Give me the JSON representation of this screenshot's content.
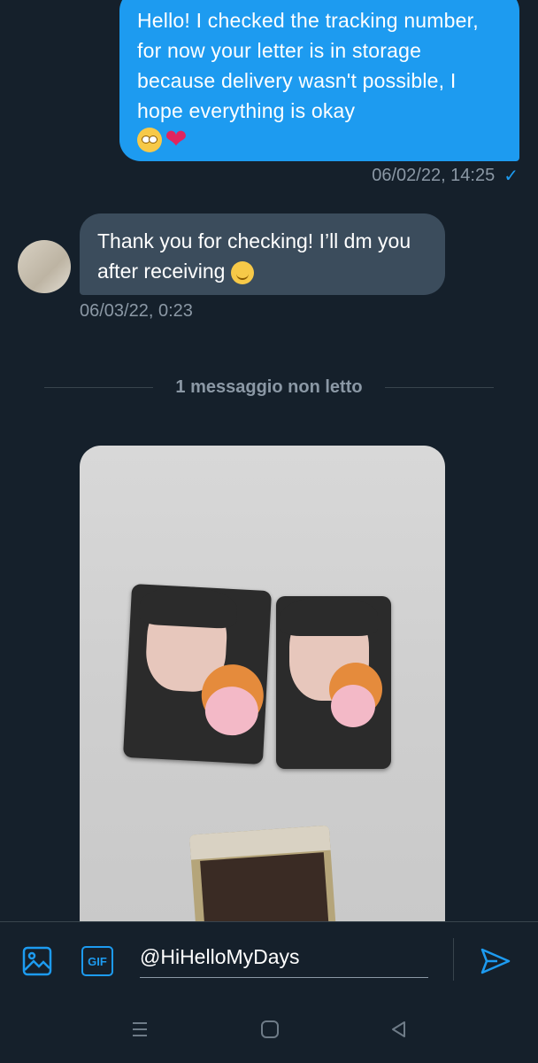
{
  "messages": {
    "outgoing": {
      "text": "Hello! I checked the tracking number, for now your letter is in storage because delivery wasn't possible, I hope everything is okay",
      "emojis": [
        "face-with-rolling-eyes",
        "red-heart"
      ],
      "timestamp": "06/02/22, 14:25",
      "status_icon": "sent-check-icon"
    },
    "incoming": {
      "text": "Thank you for checking! I’ll dm you after receiving",
      "emoji": "smiling-face",
      "timestamp": "06/03/22, 0:23"
    },
    "unread_label": "1 messaggio non letto"
  },
  "compose": {
    "input_value": "@HiHelloMyDays",
    "media_icon": "image-icon",
    "gif_label": "GIF",
    "send_icon": "send-icon"
  },
  "colors": {
    "background": "#15202b",
    "outgoing_bubble": "#1d9bf0",
    "incoming_bubble": "#3b4c5c",
    "secondary_text": "#8b98a5"
  }
}
